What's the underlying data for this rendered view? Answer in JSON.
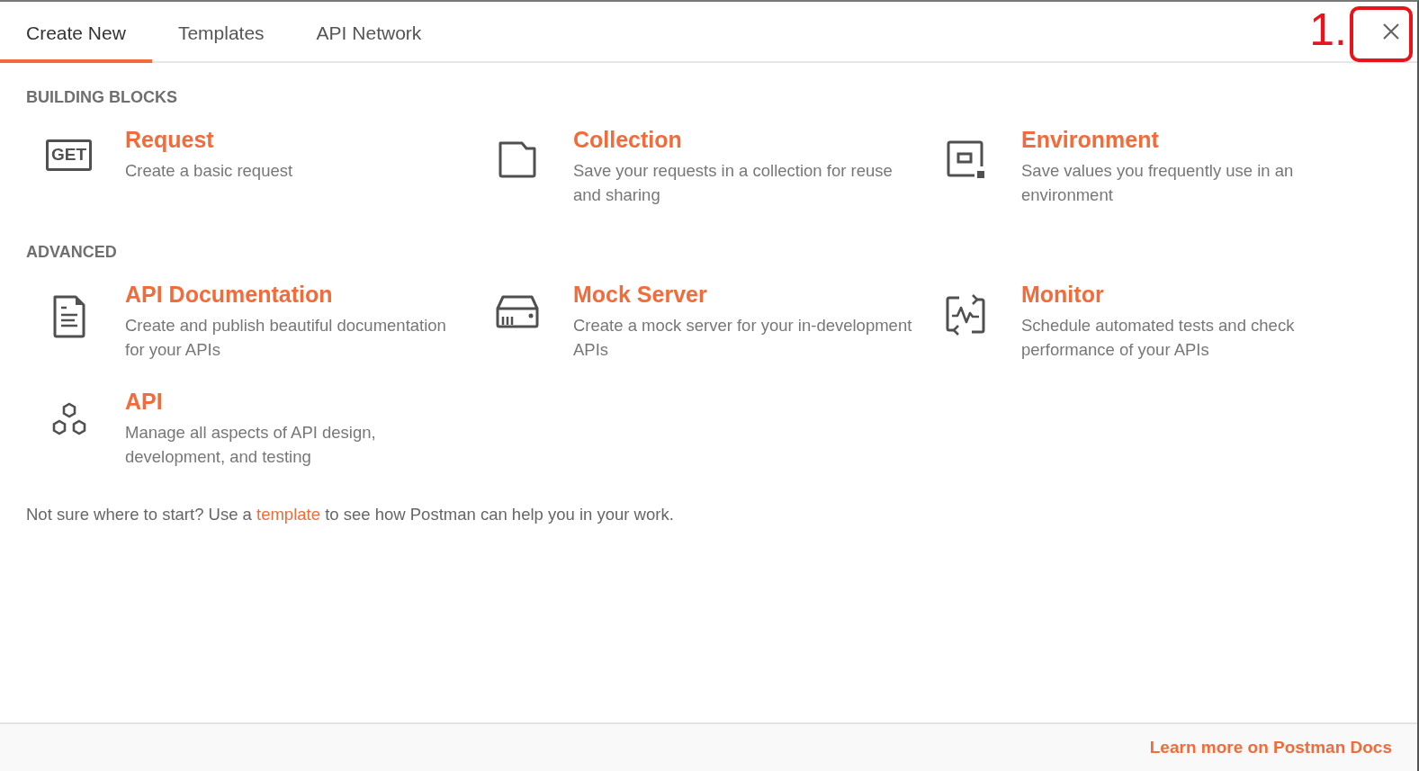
{
  "tabs": [
    {
      "label": "Create New",
      "selected": true
    },
    {
      "label": "Templates",
      "selected": false
    },
    {
      "label": "API Network",
      "selected": false
    }
  ],
  "annotation": {
    "label": "1."
  },
  "sections": [
    {
      "heading": "BUILDING BLOCKS",
      "items": [
        {
          "kind": "request",
          "icon_label": "GET",
          "title": "Request",
          "description": "Create a basic request"
        },
        {
          "kind": "collection",
          "title": "Collection",
          "description": "Save your requests in a collection for reuse and sharing"
        },
        {
          "kind": "environment",
          "title": "Environment",
          "description": "Save values you frequently use in an environment"
        }
      ]
    },
    {
      "heading": "ADVANCED",
      "items": [
        {
          "kind": "documentation",
          "title": "API Documentation",
          "description": "Create and publish beautiful documentation for your APIs"
        },
        {
          "kind": "mock-server",
          "title": "Mock Server",
          "description": "Create a mock server for your in-development APIs"
        },
        {
          "kind": "monitor",
          "title": "Monitor",
          "description": "Schedule automated tests and check performance of your APIs"
        },
        {
          "kind": "api",
          "title": "API",
          "description": "Manage all aspects of API design, development, and testing"
        }
      ]
    }
  ],
  "hint": {
    "before": "Not sure where to start? Use a",
    "link": "template",
    "after": "to see how Postman can help you in your work."
  },
  "footer": {
    "link": "Learn more on Postman Docs"
  }
}
